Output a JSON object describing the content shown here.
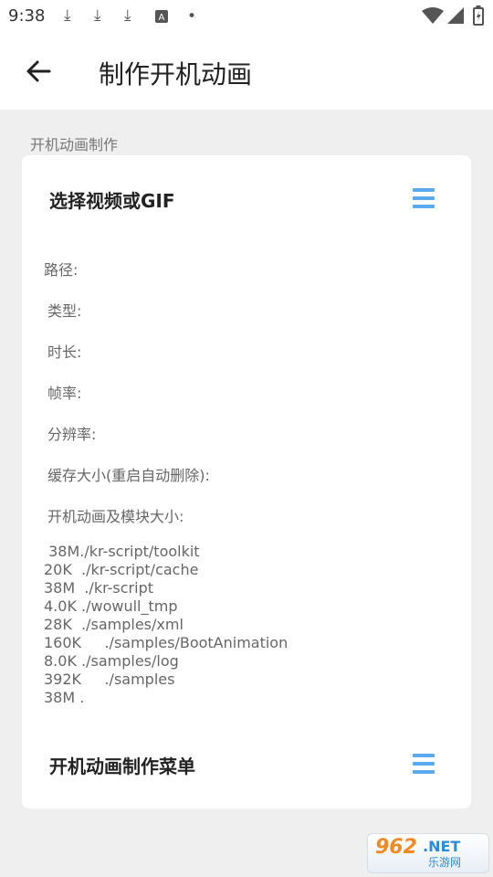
{
  "status_bar": {
    "time": "9:38",
    "notification_icons": [
      "download-icon",
      "download-icon",
      "download-icon",
      "font-app-icon",
      "dot-icon"
    ],
    "system_icons": [
      "wifi-icon",
      "signal-icon",
      "battery-charging-icon"
    ]
  },
  "app_bar": {
    "title": "制作开机动画",
    "back_icon": "arrow-left-icon"
  },
  "section": {
    "label": "开机动画制作"
  },
  "card": {
    "header1": {
      "title": "选择视频或GIF",
      "icon": "menu-icon"
    },
    "info": {
      "path": "路径:",
      "type": "类型:",
      "duration": "时长:",
      "framerate": "帧率:",
      "resolution": "分辨率:",
      "cache": "缓存大小(重启自动删除):",
      "module_size": "开机动画及模块大小:"
    },
    "sizes": [
      " 38M./kr-script/toolkit",
      "20K  ./kr-script/cache",
      "38M  ./kr-script",
      "4.0K ./wowull_tmp",
      "28K  ./samples/xml",
      "160K     ./samples/BootAnimation",
      "8.0K ./samples/log",
      "392K     ./samples",
      "38M ."
    ],
    "header2": {
      "title": "开机动画制作菜单",
      "icon": "menu-icon"
    }
  },
  "watermark": {
    "number": "962",
    "net": ".NET",
    "cn": "乐游网"
  },
  "colors": {
    "accent": "#5aaaf0",
    "background": "#efefef",
    "card": "#ffffff"
  }
}
